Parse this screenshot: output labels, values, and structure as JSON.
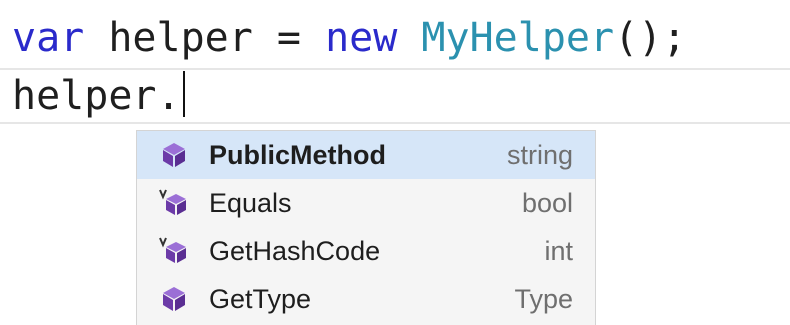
{
  "code": {
    "line1": {
      "kw_var": "var",
      "text_helper_assign": " helper = ",
      "kw_new": "new",
      "space": " ",
      "type_name": "MyHelper",
      "rest": "();"
    },
    "line2": {
      "text": "helper."
    }
  },
  "completion": {
    "items": [
      {
        "label": "PublicMethod",
        "type": "string",
        "icon": "method-icon",
        "selected": true
      },
      {
        "label": "Equals",
        "type": "bool",
        "icon": "virtual-method-icon",
        "selected": false
      },
      {
        "label": "GetHashCode",
        "type": "int",
        "icon": "virtual-method-icon",
        "selected": false
      },
      {
        "label": "GetType",
        "type": "Type",
        "icon": "method-icon",
        "selected": false
      }
    ]
  },
  "colors": {
    "keyword": "#2a2acb",
    "type": "#2b91af",
    "method_icon": "#6c3ba8",
    "selected_bg": "#d6e6f8"
  }
}
